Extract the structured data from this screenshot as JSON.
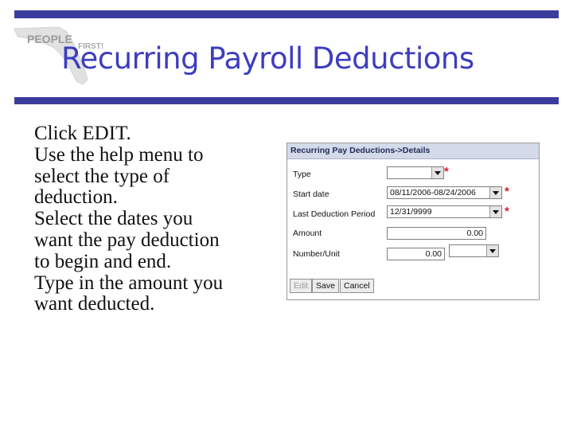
{
  "logo": {
    "text": "PEOPLE",
    "text2": "FIRST!"
  },
  "page_title": "Recurring Payroll Deductions",
  "instructions": [
    "Click EDIT.",
    "Use the help menu to",
    "select the type of",
    "deduction.",
    "Select the dates you",
    "want the pay deduction",
    "to begin and end.",
    "Type in the amount you",
    "want deducted."
  ],
  "panel": {
    "title": "Recurring Pay Deductions->Details",
    "fields": {
      "type": {
        "label": "Type",
        "value": ""
      },
      "start_date": {
        "label": "Start date",
        "value": "08/11/2006-08/24/2006"
      },
      "last_period": {
        "label": "Last Deduction Period",
        "value": "12/31/9999"
      },
      "amount": {
        "label": "Amount",
        "value": "0.00"
      },
      "number_unit": {
        "label": "Number/Unit",
        "value": "0.00",
        "unit_value": ""
      }
    },
    "required_marker": "*",
    "buttons": {
      "edit": "Edit",
      "save": "Save",
      "cancel": "Cancel"
    }
  },
  "colors": {
    "accent_bar": "#3c3c9e",
    "title": "#3d3dc0",
    "header_bg": "#d3daea",
    "required": "#d42020"
  }
}
